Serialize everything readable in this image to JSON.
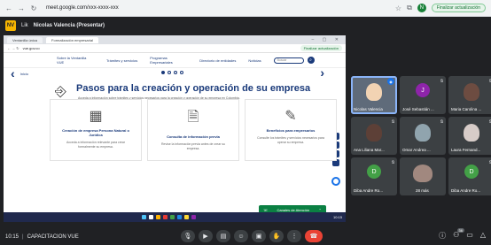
{
  "browser": {
    "url": "meet.google.com/xxx-xxxx-xxx",
    "profile_initial": "N",
    "profile_pill": "Finalizar actualización"
  },
  "meet": {
    "badge": "NV",
    "prefix": "Lik",
    "presenter_title": "Nicolas Valencia (Presentar)"
  },
  "inner_browser": {
    "tabs": [
      "Ventanilla única",
      "Formalización empresarial"
    ],
    "address": "vue.gov.co",
    "pill": "Finalizar actualización"
  },
  "site": {
    "nav": [
      "Sobre la Ventanilla VUE",
      "Trámites y servicios",
      "Programas Empresariales",
      "Directorio de entidades",
      "Noticias"
    ],
    "search_placeholder": "Buscar",
    "breadcrumb": "Inicio",
    "hero_title": "Pasos para la creación y operación de su empresa",
    "hero_desc": "Acceda a información sobre trámites y servicios necesarios para la creación y operación de su empresa en Colombia.",
    "cards": [
      {
        "title": "Creación de empresa Persona Natural o Jurídica",
        "desc": "Acceda a información relevante para crear formalmente su empresa."
      },
      {
        "title": "Consulta de información previa",
        "desc": "Revise la información previa antes de crear su empresa."
      },
      {
        "title": "Beneficios para empresarios",
        "desc": "Consulte los trámites y servicios necesarios para operar su empresa."
      }
    ],
    "chat_label": "Canales de Atención"
  },
  "taskbar": {
    "clock": "10:15"
  },
  "participants": [
    {
      "name": "Nicolas Valencia",
      "initial": "",
      "color": "",
      "camera": true
    },
    {
      "name": "José Sebastián ...",
      "initial": "J",
      "color": "#8e24aa",
      "camera": false
    },
    {
      "name": "Maria Carolina ...",
      "initial": "",
      "color": "",
      "camera": true
    },
    {
      "name": "Ana Liliana Mar...",
      "initial": "",
      "color": "",
      "camera": true
    },
    {
      "name": "Omar Andrea ...",
      "initial": "",
      "color": "",
      "camera": true
    },
    {
      "name": "Laura Fernand...",
      "initial": "",
      "color": "",
      "camera": true
    },
    {
      "name": "Diba Andre Ro...",
      "initial": "D",
      "color": "#43a047",
      "camera": false
    },
    {
      "name": "28 más",
      "initial": "",
      "color": "",
      "camera": true
    },
    {
      "name": "Diba Andre Ro...",
      "initial": "D",
      "color": "#43a047",
      "camera": false
    }
  ],
  "meeting": {
    "time": "10:15",
    "name": "CAPACITACION VUE",
    "participant_count": "36"
  }
}
